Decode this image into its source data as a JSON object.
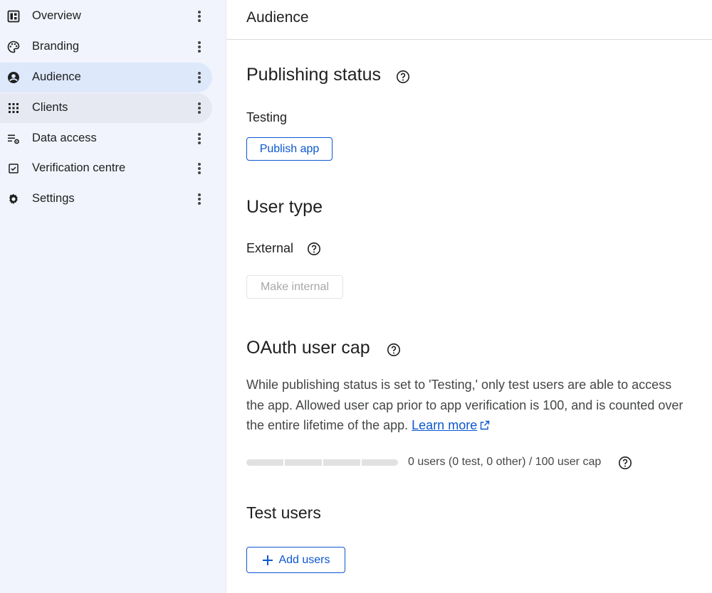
{
  "sidebar": {
    "items": [
      {
        "label": "Overview",
        "icon": "dashboard-icon"
      },
      {
        "label": "Branding",
        "icon": "palette-icon"
      },
      {
        "label": "Audience",
        "icon": "account-circle-icon",
        "active": true
      },
      {
        "label": "Clients",
        "icon": "apps-grid-icon"
      },
      {
        "label": "Data access",
        "icon": "data-settings-icon"
      },
      {
        "label": "Verification centre",
        "icon": "verified-checkbox-icon"
      },
      {
        "label": "Settings",
        "icon": "gear-icon"
      }
    ]
  },
  "header": {
    "title": "Audience"
  },
  "publishing": {
    "title": "Publishing status",
    "status": "Testing",
    "publish_button": "Publish app"
  },
  "user_type": {
    "title": "User type",
    "value": "External",
    "make_internal_button": "Make internal"
  },
  "oauth_cap": {
    "title": "OAuth user cap",
    "description": "While publishing status is set to 'Testing,' only test users are able to access the app. Allowed user cap prior to app verification is 100, and is counted over the entire lifetime of the app.",
    "learn_more": "Learn more",
    "usage_fraction": 0,
    "usage_text": "0 users (0 test, 0 other) / 100 user cap"
  },
  "test_users": {
    "title": "Test users",
    "add_button": "Add users"
  },
  "colors": {
    "accent": "#0b57d0",
    "sidebar_bg": "#f1f4fc",
    "active_item_bg": "#dde8fb",
    "text_secondary": "#444746"
  }
}
